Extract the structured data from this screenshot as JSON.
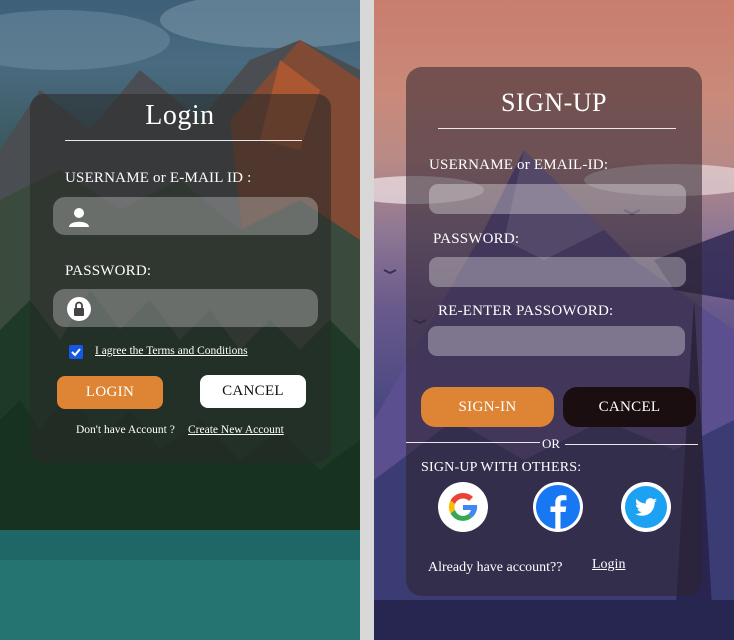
{
  "login": {
    "title": "Login",
    "username_label": "USERNAME or E-MAIL ID :",
    "password_label": "PASSWORD:",
    "username_icon": "user-icon",
    "password_icon": "lock-icon",
    "terms_checked": true,
    "terms_text": "I agree the Terms and Conditions",
    "login_button": "LOGIN",
    "cancel_button": "CANCEL",
    "no_account_text": "Don't have Account ?",
    "create_account_link": "Create New Account"
  },
  "signup": {
    "title": "SIGN-UP",
    "username_label": "USERNAME or EMAIL-ID:",
    "password_label": "PASSWORD:",
    "reenter_label": "RE-ENTER PASSOWORD:",
    "signin_button": "SIGN-IN",
    "cancel_button": "CANCEL",
    "or_text": "OR",
    "others_label": "SIGN-UP WITH OTHERS:",
    "social_icons": [
      "google-icon",
      "facebook-icon",
      "twitter-icon"
    ],
    "already_text": "Already have account??",
    "login_link": "Login"
  },
  "colors": {
    "accent_orange": "#dd8435",
    "checkbox_blue": "#1557e6",
    "cancel_dark": "#1a0e10",
    "facebook_blue": "#1877f2",
    "twitter_blue": "#1da1f2"
  }
}
